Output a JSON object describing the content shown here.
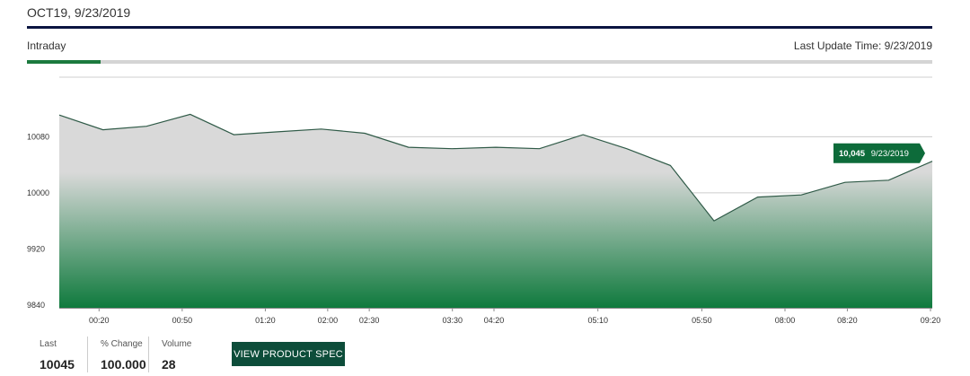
{
  "header": {
    "contract": "OCT19, 9/23/2019"
  },
  "tabs": {
    "active": "Intraday",
    "last_update_label": "Last Update Time: 9/23/2019"
  },
  "colors": {
    "line": "#2f5a47",
    "fill_top": "#d9d9d9",
    "fill_bottom": "#0f7a3d",
    "tooltip_bg": "#0d6b3a"
  },
  "tooltip": {
    "value": "10,045",
    "date": "9/23/2019"
  },
  "stats": {
    "last_label": "Last",
    "last_value": "10045",
    "change_label": "% Change",
    "change_value": "100.000",
    "volume_label": "Volume",
    "volume_value": "28"
  },
  "button": {
    "label": "VIEW PRODUCT SPEC"
  },
  "chart_data": {
    "type": "area",
    "x_tick_labels": [
      "00:20",
      "00:50",
      "01:20",
      "02:00",
      "02:30",
      "03:30",
      "04:20",
      "05:10",
      "05:50",
      "08:00",
      "08:20",
      "09:20"
    ],
    "y_tick_labels": [
      "10080",
      "10000",
      "9920",
      "9840"
    ],
    "ylim": [
      9836,
      10165
    ],
    "grid": "horizontal",
    "series": [
      {
        "values": [
          10111,
          10090,
          10095,
          10112,
          10083,
          10087,
          10091,
          10085,
          10065,
          10063,
          10065,
          10063,
          10083,
          10063,
          10039,
          9960,
          9994,
          9997,
          10015,
          10018,
          10045
        ]
      }
    ]
  }
}
